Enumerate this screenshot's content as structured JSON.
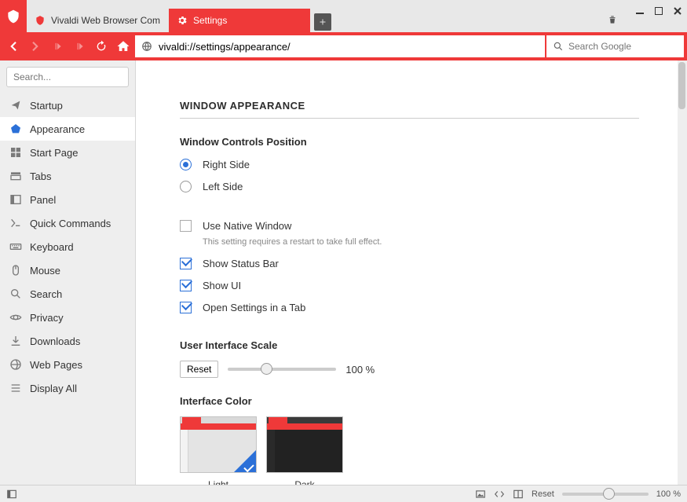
{
  "tabs": [
    {
      "label": "Vivaldi Web Browser Com",
      "active": false
    },
    {
      "label": "Settings",
      "active": true
    }
  ],
  "url": "vivaldi://settings/appearance/",
  "search_placeholder": "Search Google",
  "sidebar_search_placeholder": "Search...",
  "sidebar": {
    "items": [
      {
        "label": "Startup"
      },
      {
        "label": "Appearance"
      },
      {
        "label": "Start Page"
      },
      {
        "label": "Tabs"
      },
      {
        "label": "Panel"
      },
      {
        "label": "Quick Commands"
      },
      {
        "label": "Keyboard"
      },
      {
        "label": "Mouse"
      },
      {
        "label": "Search"
      },
      {
        "label": "Privacy"
      },
      {
        "label": "Downloads"
      },
      {
        "label": "Web Pages"
      },
      {
        "label": "Display All"
      }
    ],
    "active_index": 1
  },
  "settings": {
    "section_title": "WINDOW APPEARANCE",
    "controls_position": {
      "heading": "Window Controls Position",
      "options": [
        "Right Side",
        "Left Side"
      ],
      "selected": 0
    },
    "checkboxes": {
      "native_window": {
        "label": "Use Native Window",
        "checked": false,
        "hint": "This setting requires a restart to take full effect."
      },
      "status_bar": {
        "label": "Show Status Bar",
        "checked": true
      },
      "show_ui": {
        "label": "Show UI",
        "checked": true
      },
      "settings_tab": {
        "label": "Open Settings in a Tab",
        "checked": true
      }
    },
    "ui_scale": {
      "heading": "User Interface Scale",
      "reset_label": "Reset",
      "value_text": "100 %"
    },
    "interface_color": {
      "heading": "Interface Color",
      "themes": [
        "Light",
        "Dark"
      ],
      "selected": 0
    }
  },
  "statusbar": {
    "reset_label": "Reset",
    "zoom_text": "100 %"
  }
}
